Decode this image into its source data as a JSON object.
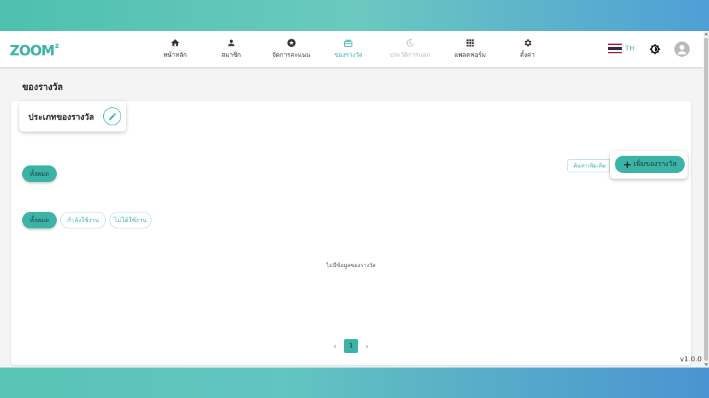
{
  "app": {
    "logo_text": "ZOOM",
    "logo_sup": "z"
  },
  "nav": {
    "items": [
      {
        "label": "หน้าหลัก",
        "icon": "home-icon"
      },
      {
        "label": "สมาชิก",
        "icon": "person-icon"
      },
      {
        "label": "จัดการคะแนน",
        "icon": "star-badge-icon"
      },
      {
        "label": "ของรางวัล",
        "icon": "gift-icon",
        "active": true
      },
      {
        "label": "ประวัติการแลก",
        "icon": "history-icon",
        "disabled": true
      },
      {
        "label": "แพลตฟอร์ม",
        "icon": "grid-icon"
      },
      {
        "label": "ตั้งค่า",
        "icon": "gear-icon"
      }
    ],
    "language": "TH",
    "language_icon": "thai-flag-icon",
    "theme_icon": "brightness-icon",
    "avatar_icon": "user-avatar-icon"
  },
  "page": {
    "title": "ของรางวัล",
    "category_title": "ประเภทของรางวัล",
    "category_filter": "ทั้งหมด",
    "search_placeholder": "ค้นหาเพิ่มเติม",
    "add_button": "เพิ่มของรางวัล",
    "status_filters": [
      "ทั้งหมด",
      "กำลังใช้งาน",
      "ไม่ได้ใช้งาน"
    ],
    "empty_message": "ไม่มีข้อมูลของรางวัล",
    "pagination": {
      "current_page": "1",
      "prev": "‹",
      "next": "›"
    },
    "version": "v1.0.0"
  },
  "colors": {
    "accent": "#3bb3a7",
    "disabled": "#b9b9b9"
  }
}
